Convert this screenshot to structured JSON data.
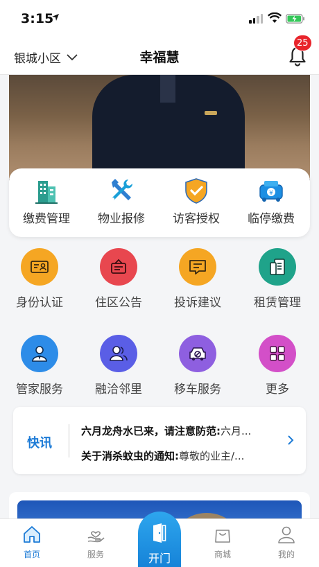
{
  "status": {
    "time": "3:15"
  },
  "header": {
    "community": "银城小区",
    "title": "幸福慧",
    "notification_count": "25"
  },
  "quick_actions": [
    {
      "label": "缴费管理",
      "icon": "building-icon"
    },
    {
      "label": "物业报修",
      "icon": "tools-icon"
    },
    {
      "label": "访客授权",
      "icon": "shield-check-icon"
    },
    {
      "label": "临停缴费",
      "icon": "parking-fee-icon"
    }
  ],
  "services": [
    {
      "label": "身份认证",
      "icon": "id-card-icon",
      "color": "#f5a623"
    },
    {
      "label": "住区公告",
      "icon": "announcement-icon",
      "color": "#e8474f"
    },
    {
      "label": "投诉建议",
      "icon": "chat-icon",
      "color": "#f5a623"
    },
    {
      "label": "租赁管理",
      "icon": "document-icon",
      "color": "#1fa38a"
    },
    {
      "label": "管家服务",
      "icon": "butler-icon",
      "color": "#2d8ce8"
    },
    {
      "label": "融洽邻里",
      "icon": "neighbors-icon",
      "color": "#5a5ee6"
    },
    {
      "label": "移车服务",
      "icon": "car-move-icon",
      "color": "#8e5fe0"
    },
    {
      "label": "更多",
      "icon": "grid-icon",
      "color": "#d34fc8"
    }
  ],
  "news": {
    "tag": "快讯",
    "items": [
      {
        "title": "六月龙舟水已来，请注意防范:",
        "snippet": "六月..."
      },
      {
        "title": "关于消杀蚊虫的通知:",
        "snippet": "尊敬的业主/..."
      }
    ]
  },
  "tabs": [
    {
      "label": "首页",
      "active": true
    },
    {
      "label": "服务",
      "active": false
    },
    {
      "label": "开门",
      "active": false
    },
    {
      "label": "商城",
      "active": false
    },
    {
      "label": "我的",
      "active": false
    }
  ],
  "colors": {
    "accent": "#1d7bd6",
    "badge": "#e8242b",
    "open_button": "#1d8fe3"
  }
}
